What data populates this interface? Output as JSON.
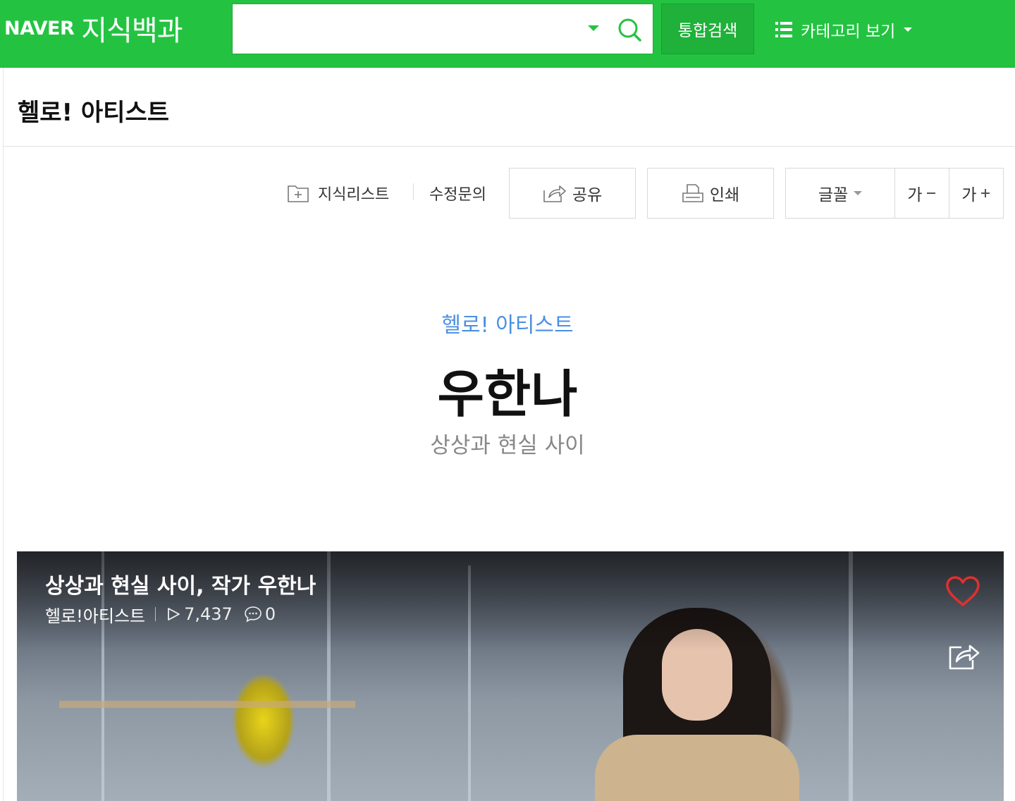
{
  "header": {
    "logo_brand": "NAVER",
    "logo_service": "지식백과",
    "search_placeholder": "",
    "search_value": "",
    "search_button": "통합검색",
    "category_button": "카테고리 보기"
  },
  "title_bar": {
    "title": "헬로! 아티스트"
  },
  "toolbar": {
    "knowledge_list": "지식리스트",
    "edit_request": "수정문의",
    "share": "공유",
    "print": "인쇄",
    "font": "글꼴",
    "font_smaller": "가",
    "font_larger": "가"
  },
  "article": {
    "category": "헬로! 아티스트",
    "title": "우한나",
    "subtitle": "상상과 현실 사이"
  },
  "video": {
    "title": "상상과 현실 사이, 작가 우한나",
    "channel": "헬로!아티스트",
    "views": "7,437",
    "comments": "0"
  },
  "colors": {
    "brand_green": "#23c341",
    "link_blue": "#4a90e2",
    "heart_red": "#e0302f"
  }
}
